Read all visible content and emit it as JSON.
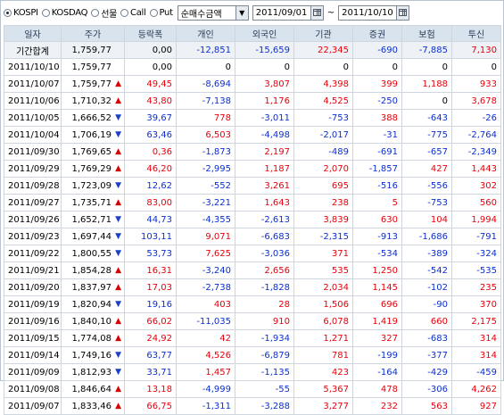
{
  "toolbar": {
    "radios": [
      {
        "label": "KOSPI",
        "selected": true
      },
      {
        "label": "KOSDAQ",
        "selected": false
      },
      {
        "label": "선물",
        "selected": false
      },
      {
        "label": "Call",
        "selected": false
      },
      {
        "label": "Put",
        "selected": false
      }
    ],
    "select_value": "순매수금액",
    "date_from": "2011/09/01",
    "date_to": "2011/10/10",
    "tilde": "~"
  },
  "table": {
    "headers": [
      "일자",
      "주가",
      "등락폭",
      "개인",
      "외국인",
      "기관",
      "증권",
      "보험",
      "투신"
    ],
    "rows": [
      {
        "date": "기간합계",
        "price": "1,759,77",
        "arrow": "",
        "change": "0,00",
        "indiv": "-12,851",
        "foreign": "-15,659",
        "inst": "22,345",
        "sec": "-690",
        "ins": "-7,885",
        "trust": "7,130",
        "total": true
      },
      {
        "date": "2011/10/10",
        "price": "1,759,77",
        "arrow": "",
        "change": "0,00",
        "indiv": "0",
        "foreign": "0",
        "inst": "0",
        "sec": "0",
        "ins": "0",
        "trust": "0"
      },
      {
        "date": "2011/10/07",
        "price": "1,759,77",
        "arrow": "up",
        "change": "49,45",
        "indiv": "-8,694",
        "foreign": "3,807",
        "inst": "4,398",
        "sec": "399",
        "ins": "1,188",
        "trust": "933"
      },
      {
        "date": "2011/10/06",
        "price": "1,710,32",
        "arrow": "up",
        "change": "43,80",
        "indiv": "-7,138",
        "foreign": "1,176",
        "inst": "4,525",
        "sec": "-250",
        "ins": "0",
        "trust": "3,678"
      },
      {
        "date": "2011/10/05",
        "price": "1,666,52",
        "arrow": "down",
        "change": "39,67",
        "indiv": "778",
        "foreign": "-3,011",
        "inst": "-753",
        "sec": "388",
        "ins": "-643",
        "trust": "-26"
      },
      {
        "date": "2011/10/04",
        "price": "1,706,19",
        "arrow": "down",
        "change": "63,46",
        "indiv": "6,503",
        "foreign": "-4,498",
        "inst": "-2,017",
        "sec": "-31",
        "ins": "-775",
        "trust": "-2,764"
      },
      {
        "date": "2011/09/30",
        "price": "1,769,65",
        "arrow": "up",
        "change": "0,36",
        "indiv": "-1,873",
        "foreign": "2,197",
        "inst": "-489",
        "sec": "-691",
        "ins": "-657",
        "trust": "-2,349"
      },
      {
        "date": "2011/09/29",
        "price": "1,769,29",
        "arrow": "up",
        "change": "46,20",
        "indiv": "-2,995",
        "foreign": "1,187",
        "inst": "2,070",
        "sec": "-1,857",
        "ins": "427",
        "trust": "1,443"
      },
      {
        "date": "2011/09/28",
        "price": "1,723,09",
        "arrow": "down",
        "change": "12,62",
        "indiv": "-552",
        "foreign": "3,261",
        "inst": "695",
        "sec": "-516",
        "ins": "-556",
        "trust": "302"
      },
      {
        "date": "2011/09/27",
        "price": "1,735,71",
        "arrow": "up",
        "change": "83,00",
        "indiv": "-3,221",
        "foreign": "1,643",
        "inst": "238",
        "sec": "5",
        "ins": "-753",
        "trust": "560"
      },
      {
        "date": "2011/09/26",
        "price": "1,652,71",
        "arrow": "down",
        "change": "44,73",
        "indiv": "-4,355",
        "foreign": "-2,613",
        "inst": "3,839",
        "sec": "630",
        "ins": "104",
        "trust": "1,994"
      },
      {
        "date": "2011/09/23",
        "price": "1,697,44",
        "arrow": "down",
        "change": "103,11",
        "indiv": "9,071",
        "foreign": "-6,683",
        "inst": "-2,315",
        "sec": "-913",
        "ins": "-1,686",
        "trust": "-791"
      },
      {
        "date": "2011/09/22",
        "price": "1,800,55",
        "arrow": "down",
        "change": "53,73",
        "indiv": "7,625",
        "foreign": "-3,036",
        "inst": "371",
        "sec": "-534",
        "ins": "-389",
        "trust": "-324"
      },
      {
        "date": "2011/09/21",
        "price": "1,854,28",
        "arrow": "up",
        "change": "16,31",
        "indiv": "-3,240",
        "foreign": "2,656",
        "inst": "535",
        "sec": "1,250",
        "ins": "-542",
        "trust": "-535"
      },
      {
        "date": "2011/09/20",
        "price": "1,837,97",
        "arrow": "up",
        "change": "17,03",
        "indiv": "-2,738",
        "foreign": "-1,828",
        "inst": "2,034",
        "sec": "1,145",
        "ins": "-102",
        "trust": "235"
      },
      {
        "date": "2011/09/19",
        "price": "1,820,94",
        "arrow": "down",
        "change": "19,16",
        "indiv": "403",
        "foreign": "28",
        "inst": "1,506",
        "sec": "696",
        "ins": "-90",
        "trust": "370"
      },
      {
        "date": "2011/09/16",
        "price": "1,840,10",
        "arrow": "up",
        "change": "66,02",
        "indiv": "-11,035",
        "foreign": "910",
        "inst": "6,078",
        "sec": "1,419",
        "ins": "660",
        "trust": "2,175"
      },
      {
        "date": "2011/09/15",
        "price": "1,774,08",
        "arrow": "up",
        "change": "24,92",
        "indiv": "42",
        "foreign": "-1,934",
        "inst": "1,271",
        "sec": "327",
        "ins": "-683",
        "trust": "314"
      },
      {
        "date": "2011/09/14",
        "price": "1,749,16",
        "arrow": "down",
        "change": "63,77",
        "indiv": "4,526",
        "foreign": "-6,879",
        "inst": "781",
        "sec": "-199",
        "ins": "-377",
        "trust": "314"
      },
      {
        "date": "2011/09/09",
        "price": "1,812,93",
        "arrow": "down",
        "change": "33,71",
        "indiv": "1,457",
        "foreign": "-1,135",
        "inst": "423",
        "sec": "-164",
        "ins": "-429",
        "trust": "-459"
      },
      {
        "date": "2011/09/08",
        "price": "1,846,64",
        "arrow": "up",
        "change": "13,18",
        "indiv": "-4,999",
        "foreign": "-55",
        "inst": "5,367",
        "sec": "478",
        "ins": "-306",
        "trust": "4,262"
      },
      {
        "date": "2011/09/07",
        "price": "1,833,46",
        "arrow": "up",
        "change": "66,75",
        "indiv": "-1,311",
        "foreign": "-3,288",
        "inst": "3,277",
        "sec": "232",
        "ins": "563",
        "trust": "927"
      }
    ]
  },
  "colors": {
    "up": "#e8000b",
    "down": "#0b2fd1",
    "header_bg": "#d9e3ee"
  }
}
